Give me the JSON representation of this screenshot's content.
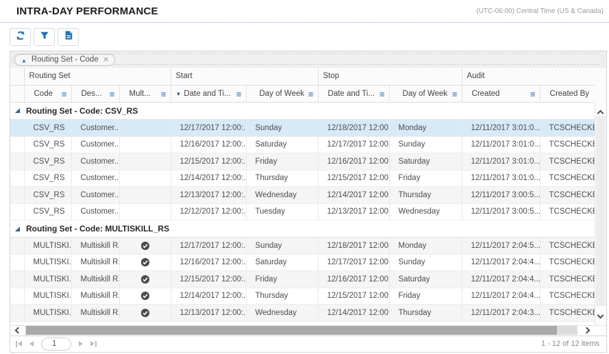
{
  "header": {
    "title": "INTRA-DAY PERFORMANCE",
    "timezone": "(UTC-06:00) Central Time (US & Canada)"
  },
  "toolbar": {
    "buttons": [
      {
        "name": "refresh",
        "icon": "refresh-icon"
      },
      {
        "name": "filter",
        "icon": "filter-icon"
      },
      {
        "name": "export",
        "icon": "export-file-icon"
      }
    ]
  },
  "grouping": {
    "chip": {
      "label": "Routing Set - Code",
      "sort": "asc",
      "sort_icon": "sort-ascending-icon",
      "remove_icon": "close-icon"
    }
  },
  "grid": {
    "column_groups": [
      {
        "label": "Routing Set"
      },
      {
        "label": "Start"
      },
      {
        "label": "Stop"
      },
      {
        "label": "Audit"
      }
    ],
    "columns": [
      {
        "label": "Code",
        "menu": true
      },
      {
        "label": "Des...",
        "menu": true
      },
      {
        "label": "Mult...",
        "menu": true
      },
      {
        "label": "Date and Ti...",
        "menu": true,
        "sorted": "desc"
      },
      {
        "label": "Day of Week",
        "menu": true
      },
      {
        "label": "Date and Ti...",
        "menu": true
      },
      {
        "label": "Day of Week",
        "menu": true
      },
      {
        "label": "Created",
        "menu": true
      },
      {
        "label": "Created By",
        "menu": false
      }
    ],
    "groups": [
      {
        "label": "Routing Set - Code: CSV_RS",
        "rows": [
          {
            "code": "CSV_RS",
            "description": "Customer...",
            "multiskill": false,
            "start_date": "12/17/2017 12:00:...",
            "start_day": "Sunday",
            "stop_date": "12/18/2017 12:00:...",
            "stop_day": "Monday",
            "created": "12/11/2017 3:01:0...",
            "created_by": "TCSCHECKER,",
            "selected": true
          },
          {
            "code": "CSV_RS",
            "description": "Customer...",
            "multiskill": false,
            "start_date": "12/16/2017 12:00:...",
            "start_day": "Saturday",
            "stop_date": "12/17/2017 12:00:...",
            "stop_day": "Sunday",
            "created": "12/11/2017 3:01:0...",
            "created_by": "TCSCHECKER,"
          },
          {
            "code": "CSV_RS",
            "description": "Customer...",
            "multiskill": false,
            "start_date": "12/15/2017 12:00:...",
            "start_day": "Friday",
            "stop_date": "12/16/2017 12:00:...",
            "stop_day": "Saturday",
            "created": "12/11/2017 3:01:0...",
            "created_by": "TCSCHECKER,"
          },
          {
            "code": "CSV_RS",
            "description": "Customer...",
            "multiskill": false,
            "start_date": "12/14/2017 12:00:...",
            "start_day": "Thursday",
            "stop_date": "12/15/2017 12:00:...",
            "stop_day": "Friday",
            "created": "12/11/2017 3:01:0...",
            "created_by": "TCSCHECKER,"
          },
          {
            "code": "CSV_RS",
            "description": "Customer...",
            "multiskill": false,
            "start_date": "12/13/2017 12:00:...",
            "start_day": "Wednesday",
            "stop_date": "12/14/2017 12:00:...",
            "stop_day": "Thursday",
            "created": "12/11/2017 3:00:5...",
            "created_by": "TCSCHECKER,"
          },
          {
            "code": "CSV_RS",
            "description": "Customer...",
            "multiskill": false,
            "start_date": "12/12/2017 12:00:...",
            "start_day": "Tuesday",
            "stop_date": "12/13/2017 12:00:...",
            "stop_day": "Wednesday",
            "created": "12/11/2017 3:00:5...",
            "created_by": "TCSCHECKER,"
          }
        ]
      },
      {
        "label": "Routing Set - Code: MULTISKILL_RS",
        "rows": [
          {
            "code": "MULTISKI...",
            "description": "Multiskill R...",
            "multiskill": true,
            "start_date": "12/17/2017 12:00:...",
            "start_day": "Sunday",
            "stop_date": "12/18/2017 12:00:...",
            "stop_day": "Monday",
            "created": "12/11/2017 2:04:5...",
            "created_by": "TCSCHECKER,"
          },
          {
            "code": "MULTISKI...",
            "description": "Multiskill R...",
            "multiskill": true,
            "start_date": "12/16/2017 12:00:...",
            "start_day": "Saturday",
            "stop_date": "12/17/2017 12:00:...",
            "stop_day": "Sunday",
            "created": "12/11/2017 2:04:4...",
            "created_by": "TCSCHECKER,"
          },
          {
            "code": "MULTISKI...",
            "description": "Multiskill R...",
            "multiskill": true,
            "start_date": "12/15/2017 12:00:...",
            "start_day": "Friday",
            "stop_date": "12/16/2017 12:00:...",
            "stop_day": "Saturday",
            "created": "12/11/2017 2:04:4...",
            "created_by": "TCSCHECKER,"
          },
          {
            "code": "MULTISKI...",
            "description": "Multiskill R...",
            "multiskill": true,
            "start_date": "12/14/2017 12:00:...",
            "start_day": "Thursday",
            "stop_date": "12/15/2017 12:00:...",
            "stop_day": "Friday",
            "created": "12/11/2017 2:04:4...",
            "created_by": "TCSCHECKER,"
          },
          {
            "code": "MULTISKI...",
            "description": "Multiskill R...",
            "multiskill": true,
            "start_date": "12/13/2017 12:00:...",
            "start_day": "Wednesday",
            "stop_date": "12/14/2017 12:00:...",
            "stop_day": "Thursday",
            "created": "12/11/2017 2:04:3...",
            "created_by": "TCSCHECKER,"
          }
        ]
      }
    ],
    "icons": {
      "column_menu": "column-menu-icon",
      "sort_descending": "sort-descending-icon",
      "collapse_group": "collapse-group-icon",
      "multiskill_check": "check-circle-icon"
    }
  },
  "pager": {
    "page": "1",
    "info": "1 - 12 of 12 items",
    "icons": [
      "first-page-icon",
      "previous-page-icon",
      "next-page-icon",
      "last-page-icon"
    ]
  },
  "colors": {
    "accent_blue": "#2272b9",
    "selected_row": "#d7eaf8",
    "alt_row": "#f5f5f5",
    "group_band": "#f0f0f0",
    "check_circle": "#4d4d4d",
    "sort_arrow": "#365a80"
  }
}
